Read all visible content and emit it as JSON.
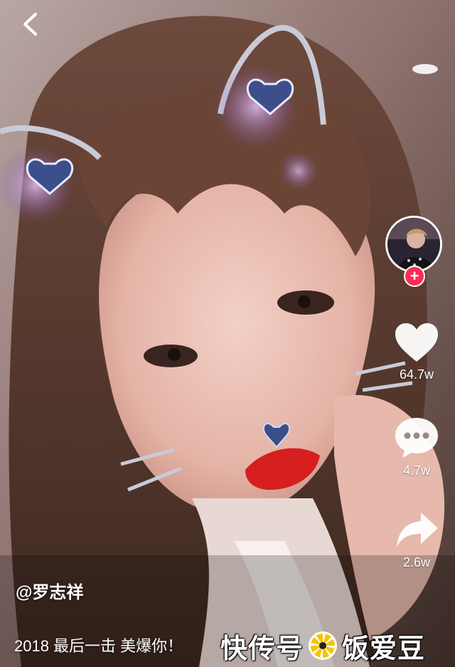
{
  "header": {
    "back_icon": "chevron-left-icon"
  },
  "profile": {
    "avatar_icon": "avatar-image",
    "follow_icon": "plus-icon",
    "follow_label": "+",
    "accent": "#fe2c55"
  },
  "actions": {
    "like": {
      "icon": "heart-icon",
      "count": "64.7w"
    },
    "comment": {
      "icon": "comment-bubble-icon",
      "count": "4.7w"
    },
    "share": {
      "icon": "share-arrow-icon",
      "count": "2.6w"
    }
  },
  "post": {
    "author": "@罗志祥",
    "caption": "2018 最后一击 美爆你！"
  },
  "watermark": {
    "left_text": "快传号",
    "right_text": "饭爱豆",
    "logo_icon": "sunburst-logo-icon"
  }
}
